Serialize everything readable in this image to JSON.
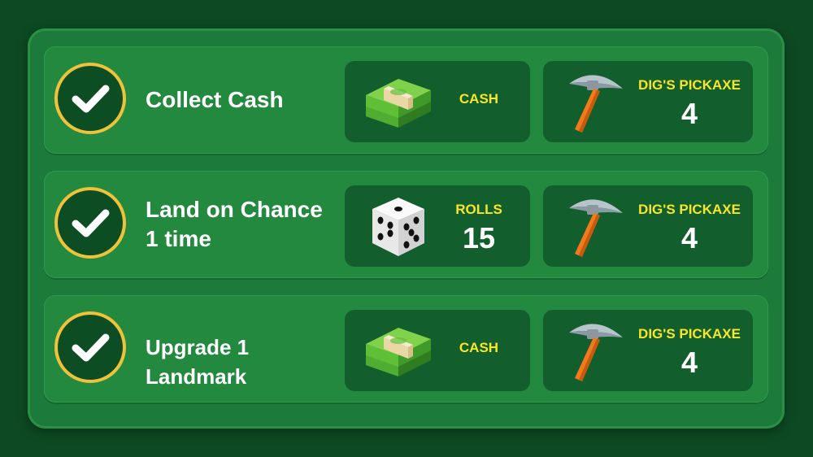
{
  "tasks": [
    {
      "label": "Collect Cash",
      "completed": true,
      "reward1": {
        "icon": "cash-stack-icon",
        "label": "CASH",
        "value": ""
      },
      "reward2": {
        "icon": "pickaxe-icon",
        "label": "DIG'S PICKAXE",
        "value": "4"
      }
    },
    {
      "label": "Land on Chance 1 time",
      "completed": true,
      "reward1": {
        "icon": "dice-icon",
        "label": "ROLLS",
        "value": "15"
      },
      "reward2": {
        "icon": "pickaxe-icon",
        "label": "DIG'S PICKAXE",
        "value": "4"
      }
    },
    {
      "label": "Upgrade 1 Landmark",
      "completed": true,
      "reward1": {
        "icon": "cash-stack-icon",
        "label": "CASH",
        "value": ""
      },
      "reward2": {
        "icon": "pickaxe-icon",
        "label": "DIG'S PICKAXE",
        "value": "4"
      }
    }
  ],
  "colors": {
    "background": "#0d4a23",
    "panel": "#1c7a3a",
    "row": "#23893f",
    "reward_tile": "#135e2d",
    "label_yellow": "#f7e62a",
    "check_ring": "#f0c23a"
  }
}
